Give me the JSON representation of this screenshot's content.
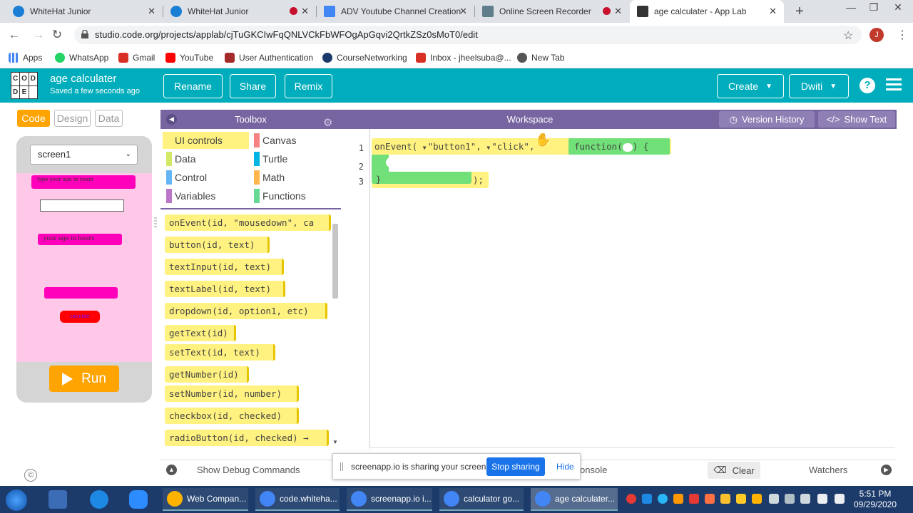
{
  "browser": {
    "tabs": [
      {
        "title": "WhiteHat Junior",
        "color": "#1a7fd4",
        "recording": false
      },
      {
        "title": "WhiteHat Junior",
        "color": "#1a7fd4",
        "recording": true
      },
      {
        "title": "ADV Youtube Channel Creation",
        "color": "#4285f4",
        "recording": false
      },
      {
        "title": "Online Screen Recorder",
        "color": "#607d8b",
        "recording": true
      },
      {
        "title": "age calculater - App Lab",
        "color": "#333333",
        "recording": false
      }
    ],
    "url": "studio.code.org/projects/applab/cjTuGKCIwFqQNLVCkFbWFOgApGqvi2QrtkZSz0sMoT0/edit",
    "avatar_letter": "J",
    "bookmarks": [
      {
        "label": "Apps",
        "color": "#4285f4"
      },
      {
        "label": "WhatsApp",
        "color": "#25d366"
      },
      {
        "label": "Gmail",
        "color": "#d93025"
      },
      {
        "label": "YouTube",
        "color": "#ff0000"
      },
      {
        "label": "User Authentication",
        "color": "#a52a2a"
      },
      {
        "label": "CourseNetworking",
        "color": "#1a3a6b"
      },
      {
        "label": "Inbox - jheelsuba@...",
        "color": "#d93025"
      },
      {
        "label": "New Tab",
        "color": "#555555"
      }
    ]
  },
  "header": {
    "logo_letters": [
      "C",
      "O",
      "D",
      "D",
      "E",
      ""
    ],
    "project_name": "age calculater",
    "saved_status": "Saved a few seconds ago",
    "rename_label": "Rename",
    "share_label": "Share",
    "remix_label": "Remix",
    "create_label": "Create",
    "user_label": "Dwiti",
    "accent_color": "#00adbc"
  },
  "left_panel": {
    "modes": [
      "Code",
      "Design",
      "Data"
    ],
    "active_mode": "Code",
    "screen_selector": "screen1",
    "app_labels": {
      "age_prompt": "type your age in years",
      "hours_label": "your age in hours",
      "calculate_button": "calculate"
    },
    "run_label": "Run"
  },
  "toolbox": {
    "title": "Toolbox",
    "categories": [
      {
        "label": "UI controls",
        "color": "#fff280",
        "selected": true
      },
      {
        "label": "Canvas",
        "color": "#f78183"
      },
      {
        "label": "Data",
        "color": "#d3e965"
      },
      {
        "label": "Turtle",
        "color": "#00b4e4"
      },
      {
        "label": "Control",
        "color": "#64b5f6"
      },
      {
        "label": "Math",
        "color": "#ffb74d"
      },
      {
        "label": "Variables",
        "color": "#bb77c7"
      },
      {
        "label": "Functions",
        "color": "#68d995"
      }
    ],
    "blocks": [
      "onEvent(id, \"mousedown\", ca",
      "button(id, text)",
      "textInput(id, text)",
      "textLabel(id, text)",
      "dropdown(id, option1, etc)",
      "getText(id)",
      "setText(id, text)",
      "getNumber(id)",
      "setNumber(id, number)",
      "checkbox(id, checked)",
      "radioButton(id, checked) →"
    ]
  },
  "workspace": {
    "title": "Workspace",
    "version_history_label": "Version History",
    "show_text_label": "Show Text",
    "line_numbers": [
      "1",
      "2",
      "3"
    ],
    "code": {
      "event_fn": "onEvent(",
      "target_id": "\"button1\",",
      "event_type": "\"click\",",
      "function_kw": "function(",
      "function_close": ") {",
      "close_brace": "}",
      "line3_end": ");"
    }
  },
  "debug": {
    "show_debug_label": "Show Debug Commands",
    "console_label": "onsole",
    "clear_label": "Clear",
    "watchers_label": "Watchers"
  },
  "screen_share": {
    "message": "screenapp.io is sharing your screen.",
    "stop_label": "Stop sharing",
    "hide_label": "Hide"
  },
  "taskbar": {
    "apps": [
      {
        "label": "Web Compan...",
        "color": "#ffb300"
      },
      {
        "label": "code.whiteha...",
        "color": "#4285f4"
      },
      {
        "label": "screenapp.io i...",
        "color": "#4285f4"
      },
      {
        "label": "calculator go...",
        "color": "#4285f4"
      },
      {
        "label": "age calculater...",
        "color": "#4285f4",
        "active": true
      }
    ],
    "time": "5:51 PM",
    "date": "09/29/2020"
  }
}
